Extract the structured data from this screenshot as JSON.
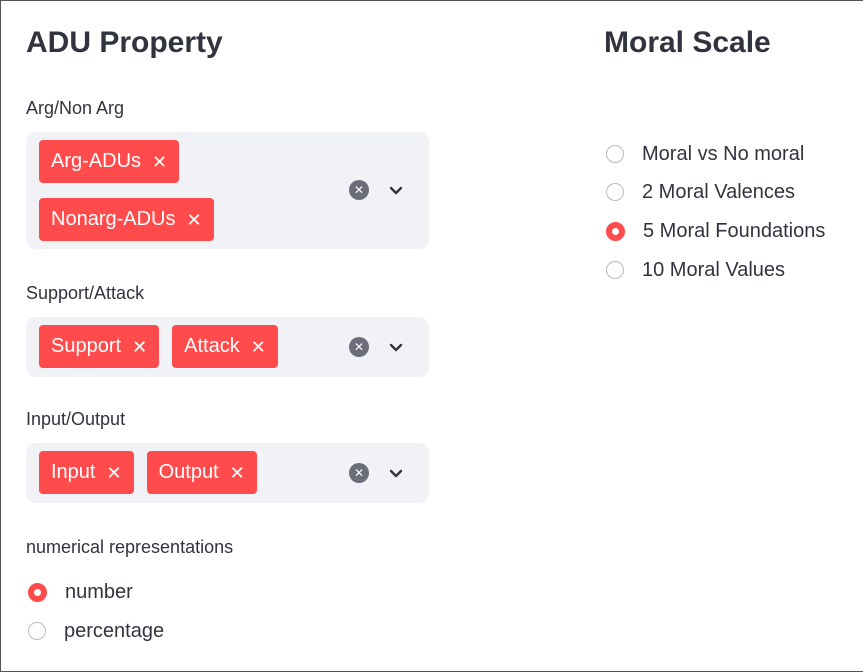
{
  "left": {
    "heading": "ADU Property",
    "arg": {
      "label": "Arg/Non Arg",
      "tags": [
        "Arg-ADUs",
        "Nonarg-ADUs"
      ]
    },
    "support": {
      "label": "Support/Attack",
      "tags": [
        "Support",
        "Attack"
      ]
    },
    "io": {
      "label": "Input/Output",
      "tags": [
        "Input",
        "Output"
      ]
    },
    "numerical": {
      "label": "numerical representations",
      "options": [
        "number",
        "percentage"
      ],
      "selected": "number"
    }
  },
  "right": {
    "heading": "Moral Scale",
    "options": [
      "Moral vs No moral",
      "2 Moral Valences",
      "5 Moral Foundations",
      "10 Moral Values"
    ],
    "selected": "5 Moral Foundations"
  },
  "colors": {
    "accent": "#ff4b4b",
    "field_bg": "#f0f2f6",
    "text": "#31333f"
  },
  "icons": {
    "tag_remove": "close-icon",
    "clear": "clear-all-icon",
    "dropdown": "chevron-down-icon"
  }
}
